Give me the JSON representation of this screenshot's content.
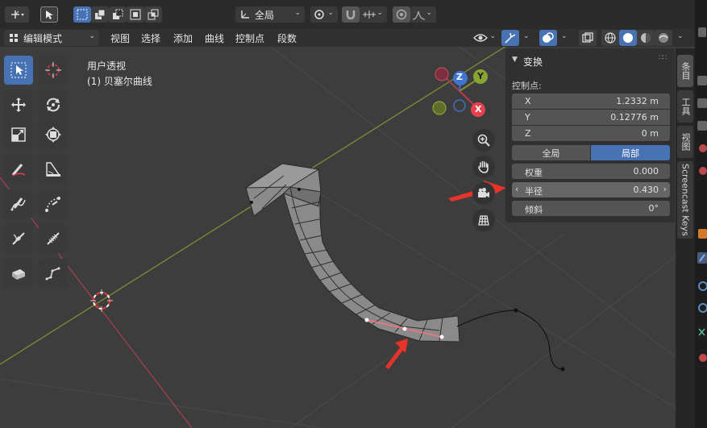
{
  "header": {
    "global_label": "全局",
    "mode_label": "编辑模式"
  },
  "menus": [
    "视图",
    "选择",
    "添加",
    "曲线",
    "控制点",
    "段数"
  ],
  "viewport": {
    "view_name": "用户透视",
    "object_label": "(1) 贝塞尔曲线"
  },
  "gizmo": {
    "z": "Z",
    "y": "Y",
    "x": "X"
  },
  "npanel": {
    "title": "变换",
    "section": "控制点:",
    "x_label": "X",
    "x_value": "1.2332 m",
    "y_label": "Y",
    "y_value": "0.12776 m",
    "z_label": "Z",
    "z_value": "0 m",
    "global_btn": "全局",
    "local_btn": "局部",
    "weight_label": "权重",
    "weight_value": "0.000",
    "radius_label": "半径",
    "radius_value": "0.430",
    "tilt_label": "倾斜",
    "tilt_value": "0°"
  },
  "side_tabs": [
    "条目",
    "工具",
    "视图",
    "Screencast Keys"
  ],
  "colors": {
    "accent": "#4772b3",
    "x_axis": "#b8485a",
    "y_axis": "#8a9b3a",
    "annotation_arrow": "#e8332a",
    "radius_handle": "#ff6f7f"
  }
}
